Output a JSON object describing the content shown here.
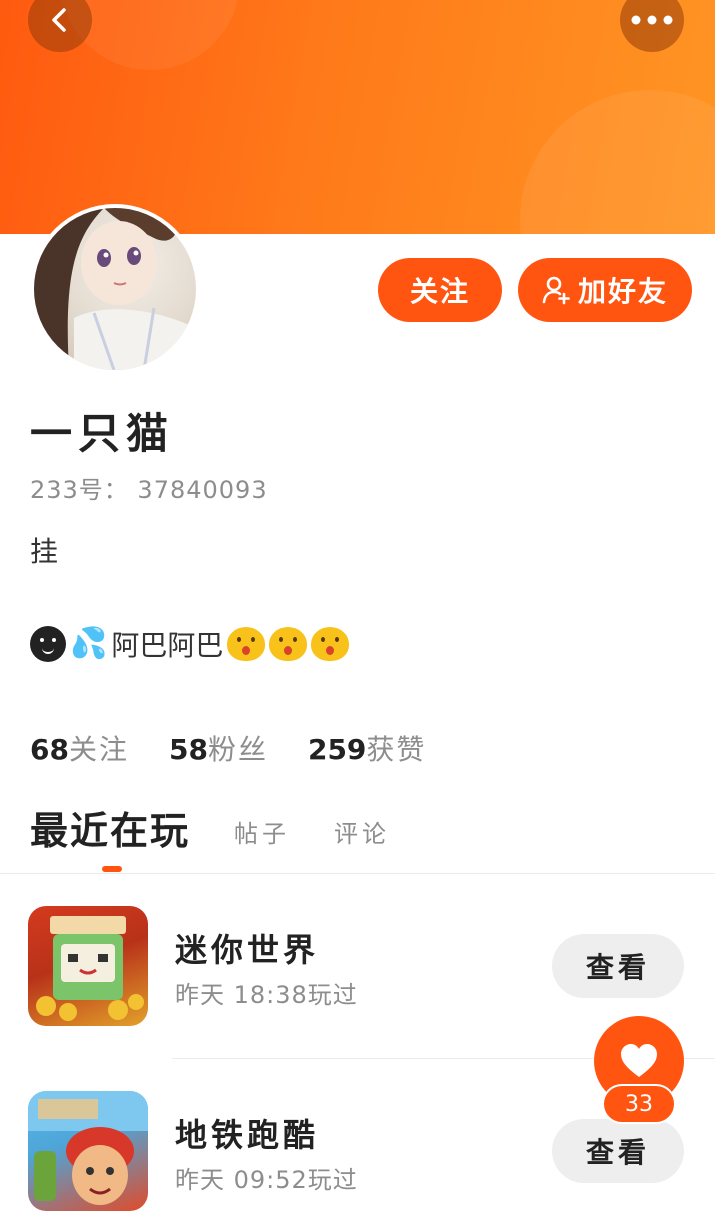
{
  "header": {
    "back_icon": "chevron-left-icon",
    "more_icon": "more-dots-icon",
    "banner_color": "#ff6a15"
  },
  "actions": {
    "follow_label": "关注",
    "add_friend_label": "加好友",
    "accent_color": "#ff5511"
  },
  "profile": {
    "nickname": "一只猫",
    "uid": "233号： 37840093",
    "bio_line1": "挂",
    "bio_line2_text": "阿巴阿巴"
  },
  "stats": {
    "following": {
      "value": "68",
      "label": "关注"
    },
    "followers": {
      "value": "58",
      "label": "粉丝"
    },
    "likes": {
      "value": "259",
      "label": "获赞"
    }
  },
  "tabs": [
    {
      "label": "最近在玩",
      "active": true
    },
    {
      "label": "帖子",
      "active": false
    },
    {
      "label": "评论",
      "active": false
    }
  ],
  "games": [
    {
      "name": "迷你世界",
      "time": "昨天 18:38玩过",
      "button": "查看",
      "icon": "mini-world-icon"
    },
    {
      "name": "地铁跑酷",
      "time": "昨天 09:52玩过",
      "button": "查看",
      "icon": "subway-surfers-icon"
    }
  ],
  "like_fab": {
    "count": "33",
    "icon": "heart-icon"
  }
}
